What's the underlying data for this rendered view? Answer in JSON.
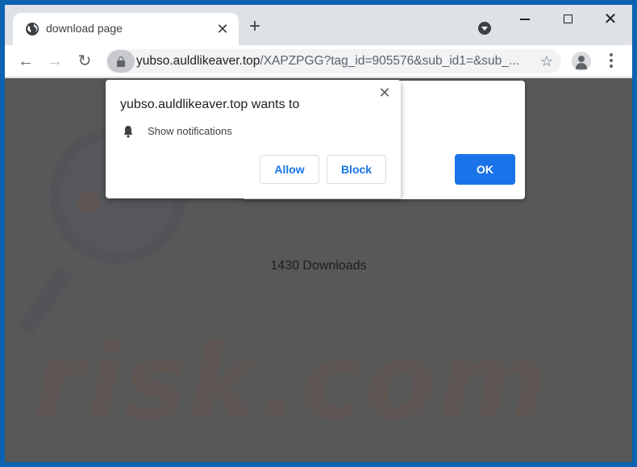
{
  "browser": {
    "tab": {
      "title": "download page",
      "icon": "globe-icon",
      "close": "✕"
    },
    "new_tab": "+",
    "window_controls": {
      "close": "✕"
    },
    "nav": {
      "back": "←",
      "forward": "→",
      "reload": "↻"
    },
    "url": {
      "host": "yubso.auldlikeaver.top",
      "path": "/XAPZPGG?tag_id=905576&sub_id1=&sub_..."
    },
    "bookmark_star": "☆"
  },
  "page": {
    "downloads_text": "1430 Downloads",
    "watermark_text": "risk.com",
    "modal": {
      "ok_label": "OK"
    }
  },
  "permission_popup": {
    "title": "yubso.auldlikeaver.top wants to",
    "close": "✕",
    "permission": "Show notifications",
    "allow_label": "Allow",
    "block_label": "Block"
  },
  "colors": {
    "accent": "#1a73e8",
    "frame": "#0b62b0",
    "page_bg": "#585858"
  }
}
